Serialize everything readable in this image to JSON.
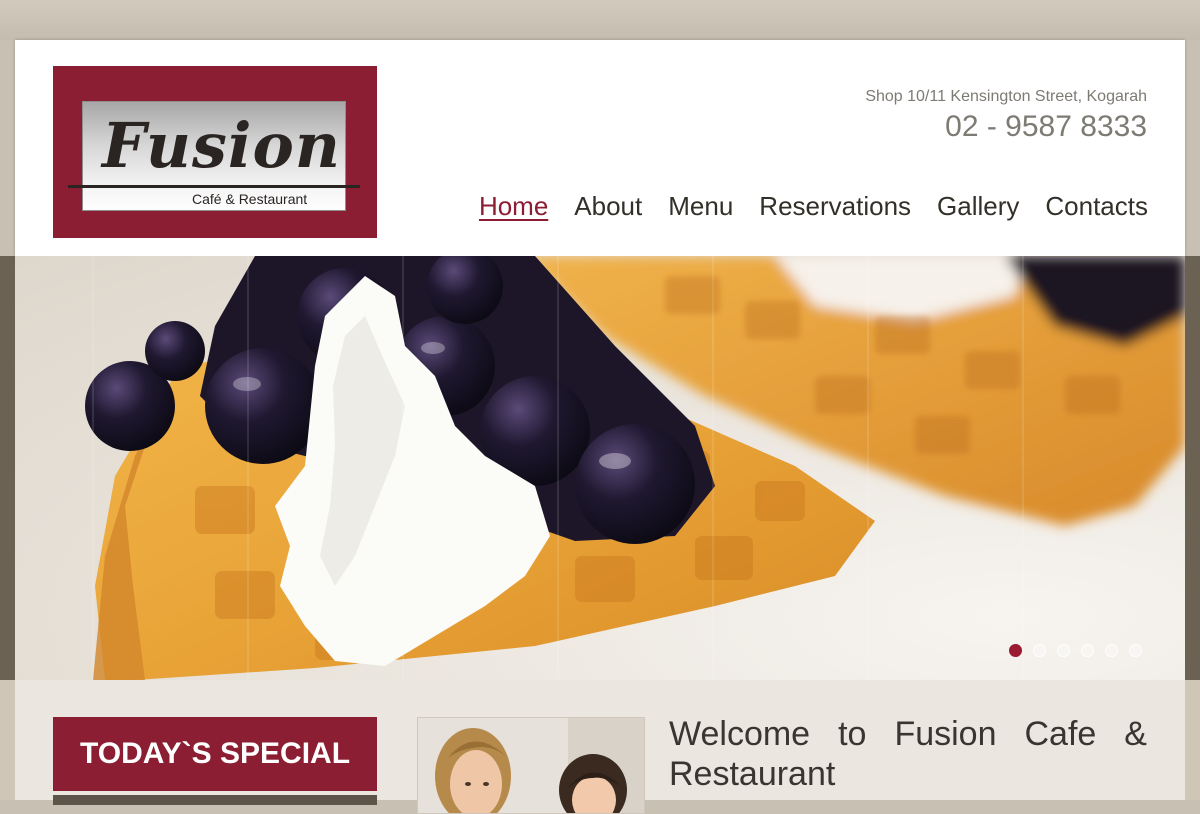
{
  "logo": {
    "name": "Fusion",
    "tagline": "Café & Restaurant"
  },
  "contact": {
    "address": "Shop 10/11 Kensington Street, Kogarah",
    "phone": "02 - 9587 8333"
  },
  "nav": {
    "items": [
      {
        "label": "Home",
        "active": true
      },
      {
        "label": "About"
      },
      {
        "label": "Menu"
      },
      {
        "label": "Reservations"
      },
      {
        "label": "Gallery"
      },
      {
        "label": "Contacts"
      }
    ]
  },
  "slider": {
    "slide_count": 6,
    "active_index": 0
  },
  "special": {
    "title": "TODAY`S SPECIAL"
  },
  "welcome": {
    "title": "Welcome to Fusion Cafe & Restaurant"
  },
  "colors": {
    "brand": "#8b1e32",
    "active_dot": "#9b1b30",
    "text": "#333029",
    "muted": "#7e7a74"
  }
}
